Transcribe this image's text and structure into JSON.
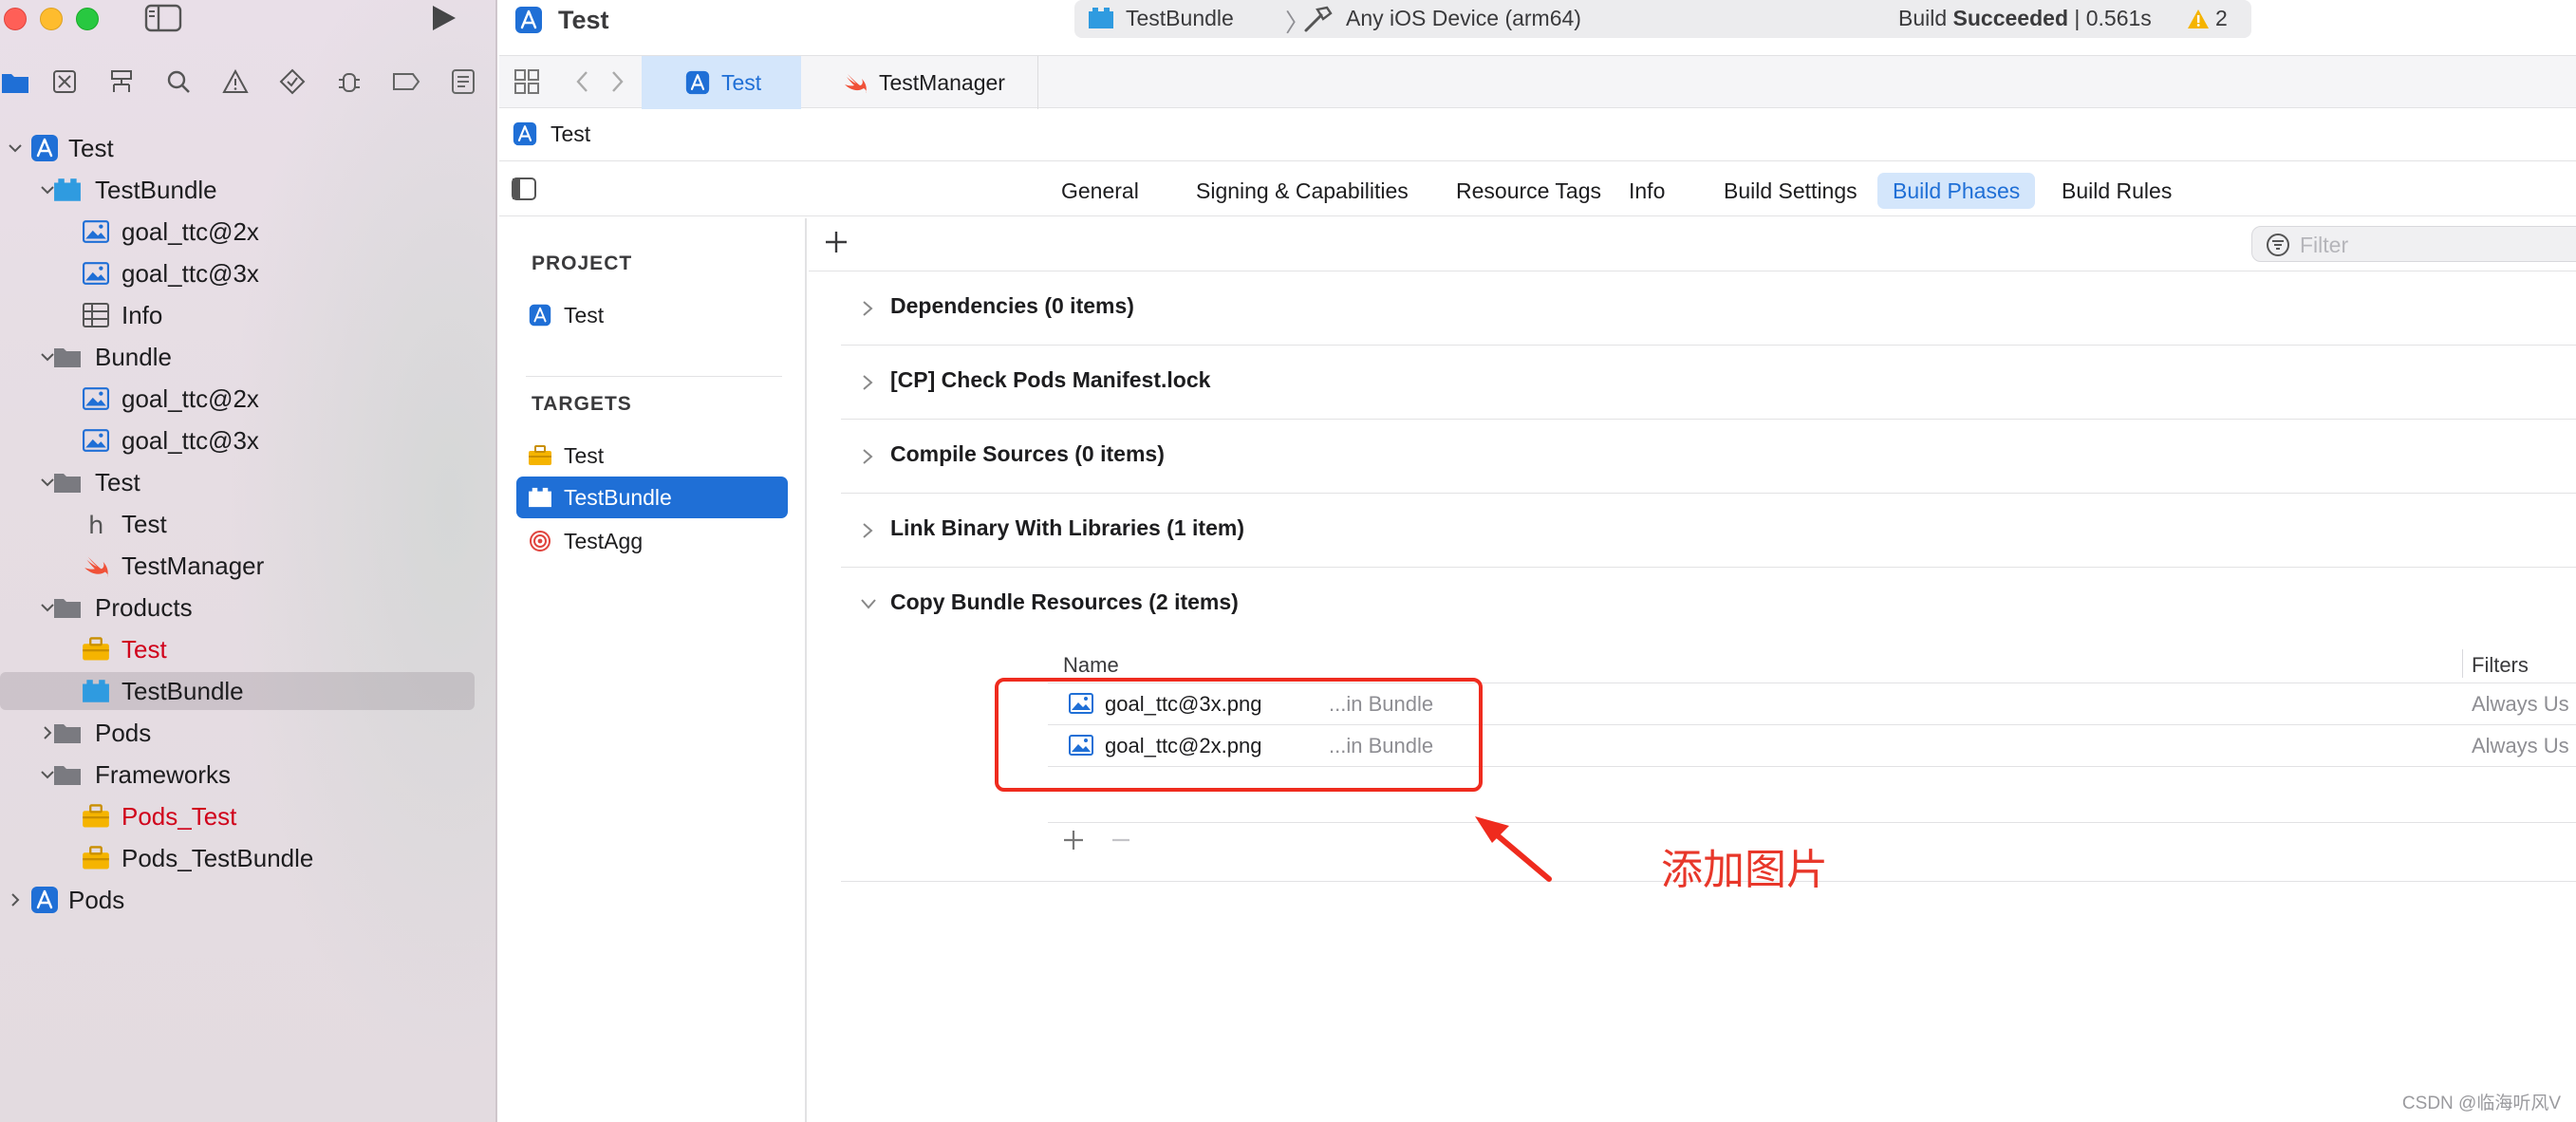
{
  "window": {
    "title": "Test"
  },
  "scheme": {
    "bundle": "TestBundle",
    "device": "Any iOS Device (arm64)",
    "status_prefix": "Build ",
    "status_bold": "Succeeded",
    "status_time": " | 0.561s",
    "warnings": "2"
  },
  "navigator_tree": [
    {
      "label": "Test",
      "icon": "app-icon",
      "chev": "down",
      "level": 0
    },
    {
      "label": "TestBundle",
      "icon": "bundle-icon",
      "chev": "down",
      "level": 1
    },
    {
      "label": "goal_ttc@2x",
      "icon": "image-icon",
      "chev": "",
      "level": 2
    },
    {
      "label": "goal_ttc@3x",
      "icon": "image-icon",
      "chev": "",
      "level": 2
    },
    {
      "label": "Info",
      "icon": "plist-icon",
      "chev": "",
      "level": 2
    },
    {
      "label": "Bundle",
      "icon": "folder-icon",
      "chev": "down",
      "level": 1
    },
    {
      "label": "goal_ttc@2x",
      "icon": "image-icon",
      "chev": "",
      "level": 2
    },
    {
      "label": "goal_ttc@3x",
      "icon": "image-icon",
      "chev": "",
      "level": 2
    },
    {
      "label": "Test",
      "icon": "folder-icon",
      "chev": "down",
      "level": 1
    },
    {
      "label": "Test",
      "icon": "header-icon",
      "chev": "",
      "level": 2
    },
    {
      "label": "TestManager",
      "icon": "swift-icon",
      "chev": "",
      "level": 2
    },
    {
      "label": "Products",
      "icon": "folder-icon",
      "chev": "down",
      "level": 1
    },
    {
      "label": "Test",
      "icon": "toolbox-icon",
      "chev": "",
      "level": 2,
      "red": true
    },
    {
      "label": "TestBundle",
      "icon": "bundle-icon",
      "chev": "",
      "level": 2,
      "selected": true
    },
    {
      "label": "Pods",
      "icon": "folder-icon",
      "chev": "right",
      "level": 1
    },
    {
      "label": "Frameworks",
      "icon": "folder-icon",
      "chev": "down",
      "level": 1
    },
    {
      "label": "Pods_Test",
      "icon": "toolbox-icon",
      "chev": "",
      "level": 2,
      "red": true
    },
    {
      "label": "Pods_TestBundle",
      "icon": "toolbox-icon",
      "chev": "",
      "level": 2
    },
    {
      "label": "Pods",
      "icon": "app-icon",
      "chev": "right",
      "level": 0
    }
  ],
  "tabs": [
    {
      "label": "Test",
      "active": true
    },
    {
      "label": "TestManager",
      "active": false
    }
  ],
  "breadcrumb": "Test",
  "editor_tabs": [
    {
      "label": "General"
    },
    {
      "label": "Signing & Capabilities"
    },
    {
      "label": "Resource Tags"
    },
    {
      "label": "Info"
    },
    {
      "label": "Build Settings"
    },
    {
      "label": "Build Phases",
      "active": true
    },
    {
      "label": "Build Rules"
    }
  ],
  "project_section": "PROJECT",
  "project_item": "Test",
  "targets_section": "TARGETS",
  "targets": [
    {
      "label": "Test",
      "icon": "toolbox-icon"
    },
    {
      "label": "TestBundle",
      "icon": "bundle-icon",
      "selected": true
    },
    {
      "label": "TestAgg",
      "icon": "target-icon"
    }
  ],
  "filter_placeholder": "Filter",
  "phases": [
    {
      "label": "Dependencies (0 items)"
    },
    {
      "label": "[CP] Check Pods Manifest.lock"
    },
    {
      "label": "Compile Sources (0 items)"
    },
    {
      "label": "Link Binary With Libraries (1 item)"
    },
    {
      "label": "Copy Bundle Resources (2 items)",
      "expanded": true
    }
  ],
  "resources_table": {
    "name_header": "Name",
    "filters_header": "Filters",
    "rows": [
      {
        "name": "goal_ttc@3x.png",
        "location": "...in Bundle",
        "filter": "Always Us"
      },
      {
        "name": "goal_ttc@2x.png",
        "location": "...in Bundle",
        "filter": "Always Us"
      }
    ]
  },
  "annotation": "添加图片",
  "watermark": "CSDN @临海听风V",
  "colors": {
    "accent": "#1f6fd6",
    "annotation": "#ef2b1e",
    "error_text": "#d0021b"
  }
}
